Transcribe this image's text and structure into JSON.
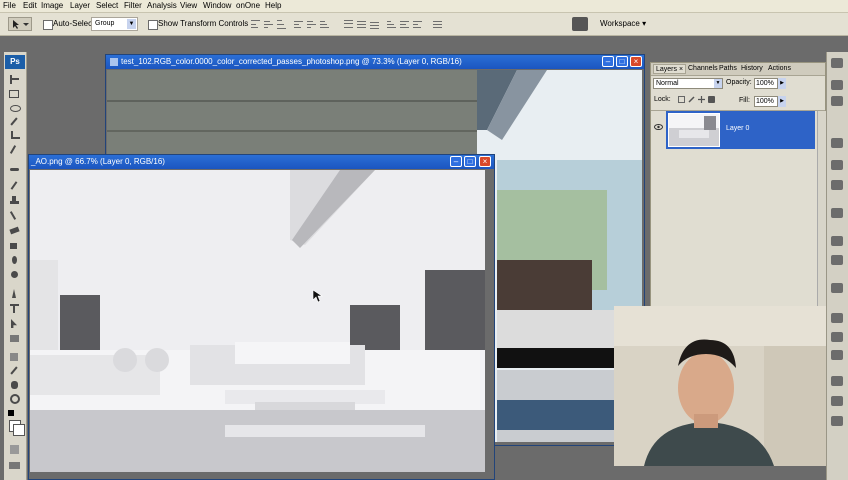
{
  "menu": [
    "File",
    "Edit",
    "Image",
    "Layer",
    "Select",
    "Filter",
    "Analysis",
    "View",
    "Window",
    "onOne",
    "Help"
  ],
  "options_bar": {
    "auto_select_label": "Auto-Select:",
    "auto_select_value": "Group",
    "transform_controls_label": "Show Transform Controls",
    "workspace_label": "Workspace ▾"
  },
  "toolbox": {
    "logo": "Ps"
  },
  "doc_window_back": {
    "title": "test_102.RGB_color.0000_color_corrected_passes_photoshop.png @ 73.3% (Layer 0, RGB/16)"
  },
  "doc_window_front": {
    "title": "_AO.png @ 66.7% (Layer 0, RGB/16)"
  },
  "layers_panel": {
    "tabs": [
      "Layers ×",
      "Channels",
      "Paths",
      "History",
      "Actions"
    ],
    "blend_mode": "Normal",
    "opacity_label": "Opacity:",
    "opacity_value": "100%",
    "lock_label": "Lock:",
    "fill_label": "Fill:",
    "fill_value": "100%",
    "layer_name": "Layer 0"
  },
  "colors": {
    "title_bar": "#1f5fcc",
    "layer_selected": "#2e63c7",
    "workspace_bg": "#6b6b6b"
  }
}
